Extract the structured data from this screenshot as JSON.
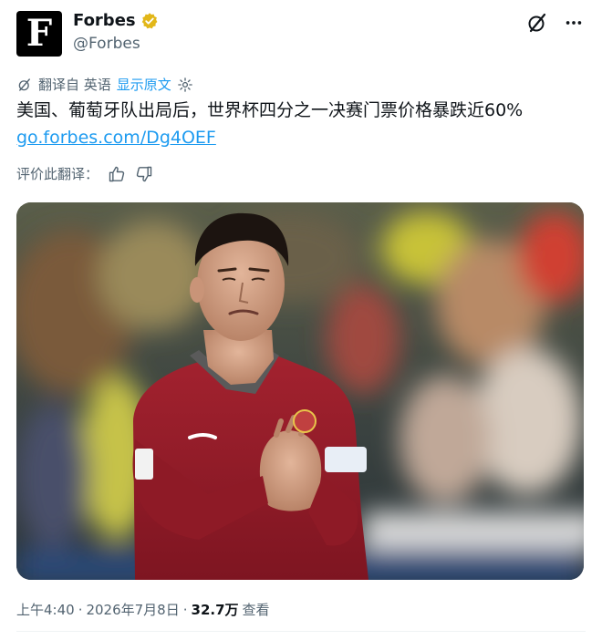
{
  "author": {
    "name": "Forbes",
    "handle": "@Forbes",
    "avatar_letter": "F",
    "verified_color": "#e2b719"
  },
  "translation": {
    "label": "翻译自 英语",
    "show_original": "显示原文"
  },
  "tweet": {
    "text": "美国、葡萄牙队出局后，世界杯四分之一决赛门票价格暴跌近60%",
    "link": "go.forbes.com/Dg4OEF"
  },
  "rate_translation": {
    "label": "评价此翻译："
  },
  "media": {
    "alt": "photo"
  },
  "meta": {
    "time": "上午4:40",
    "sep1": "·",
    "date": "2026年7月8日",
    "sep2": "·",
    "views_count": "32.7万",
    "views_label": "查看"
  },
  "colors": {
    "accent": "#1d9bf0",
    "secondary_text": "#536471",
    "jersey": "#9e1d2c"
  },
  "icons": {
    "grok": "grok-icon",
    "more": "more-icon",
    "translate": "translate-icon",
    "settings": "gear-icon",
    "thumb_up": "thumbs-up-icon",
    "thumb_down": "thumbs-down-icon"
  }
}
